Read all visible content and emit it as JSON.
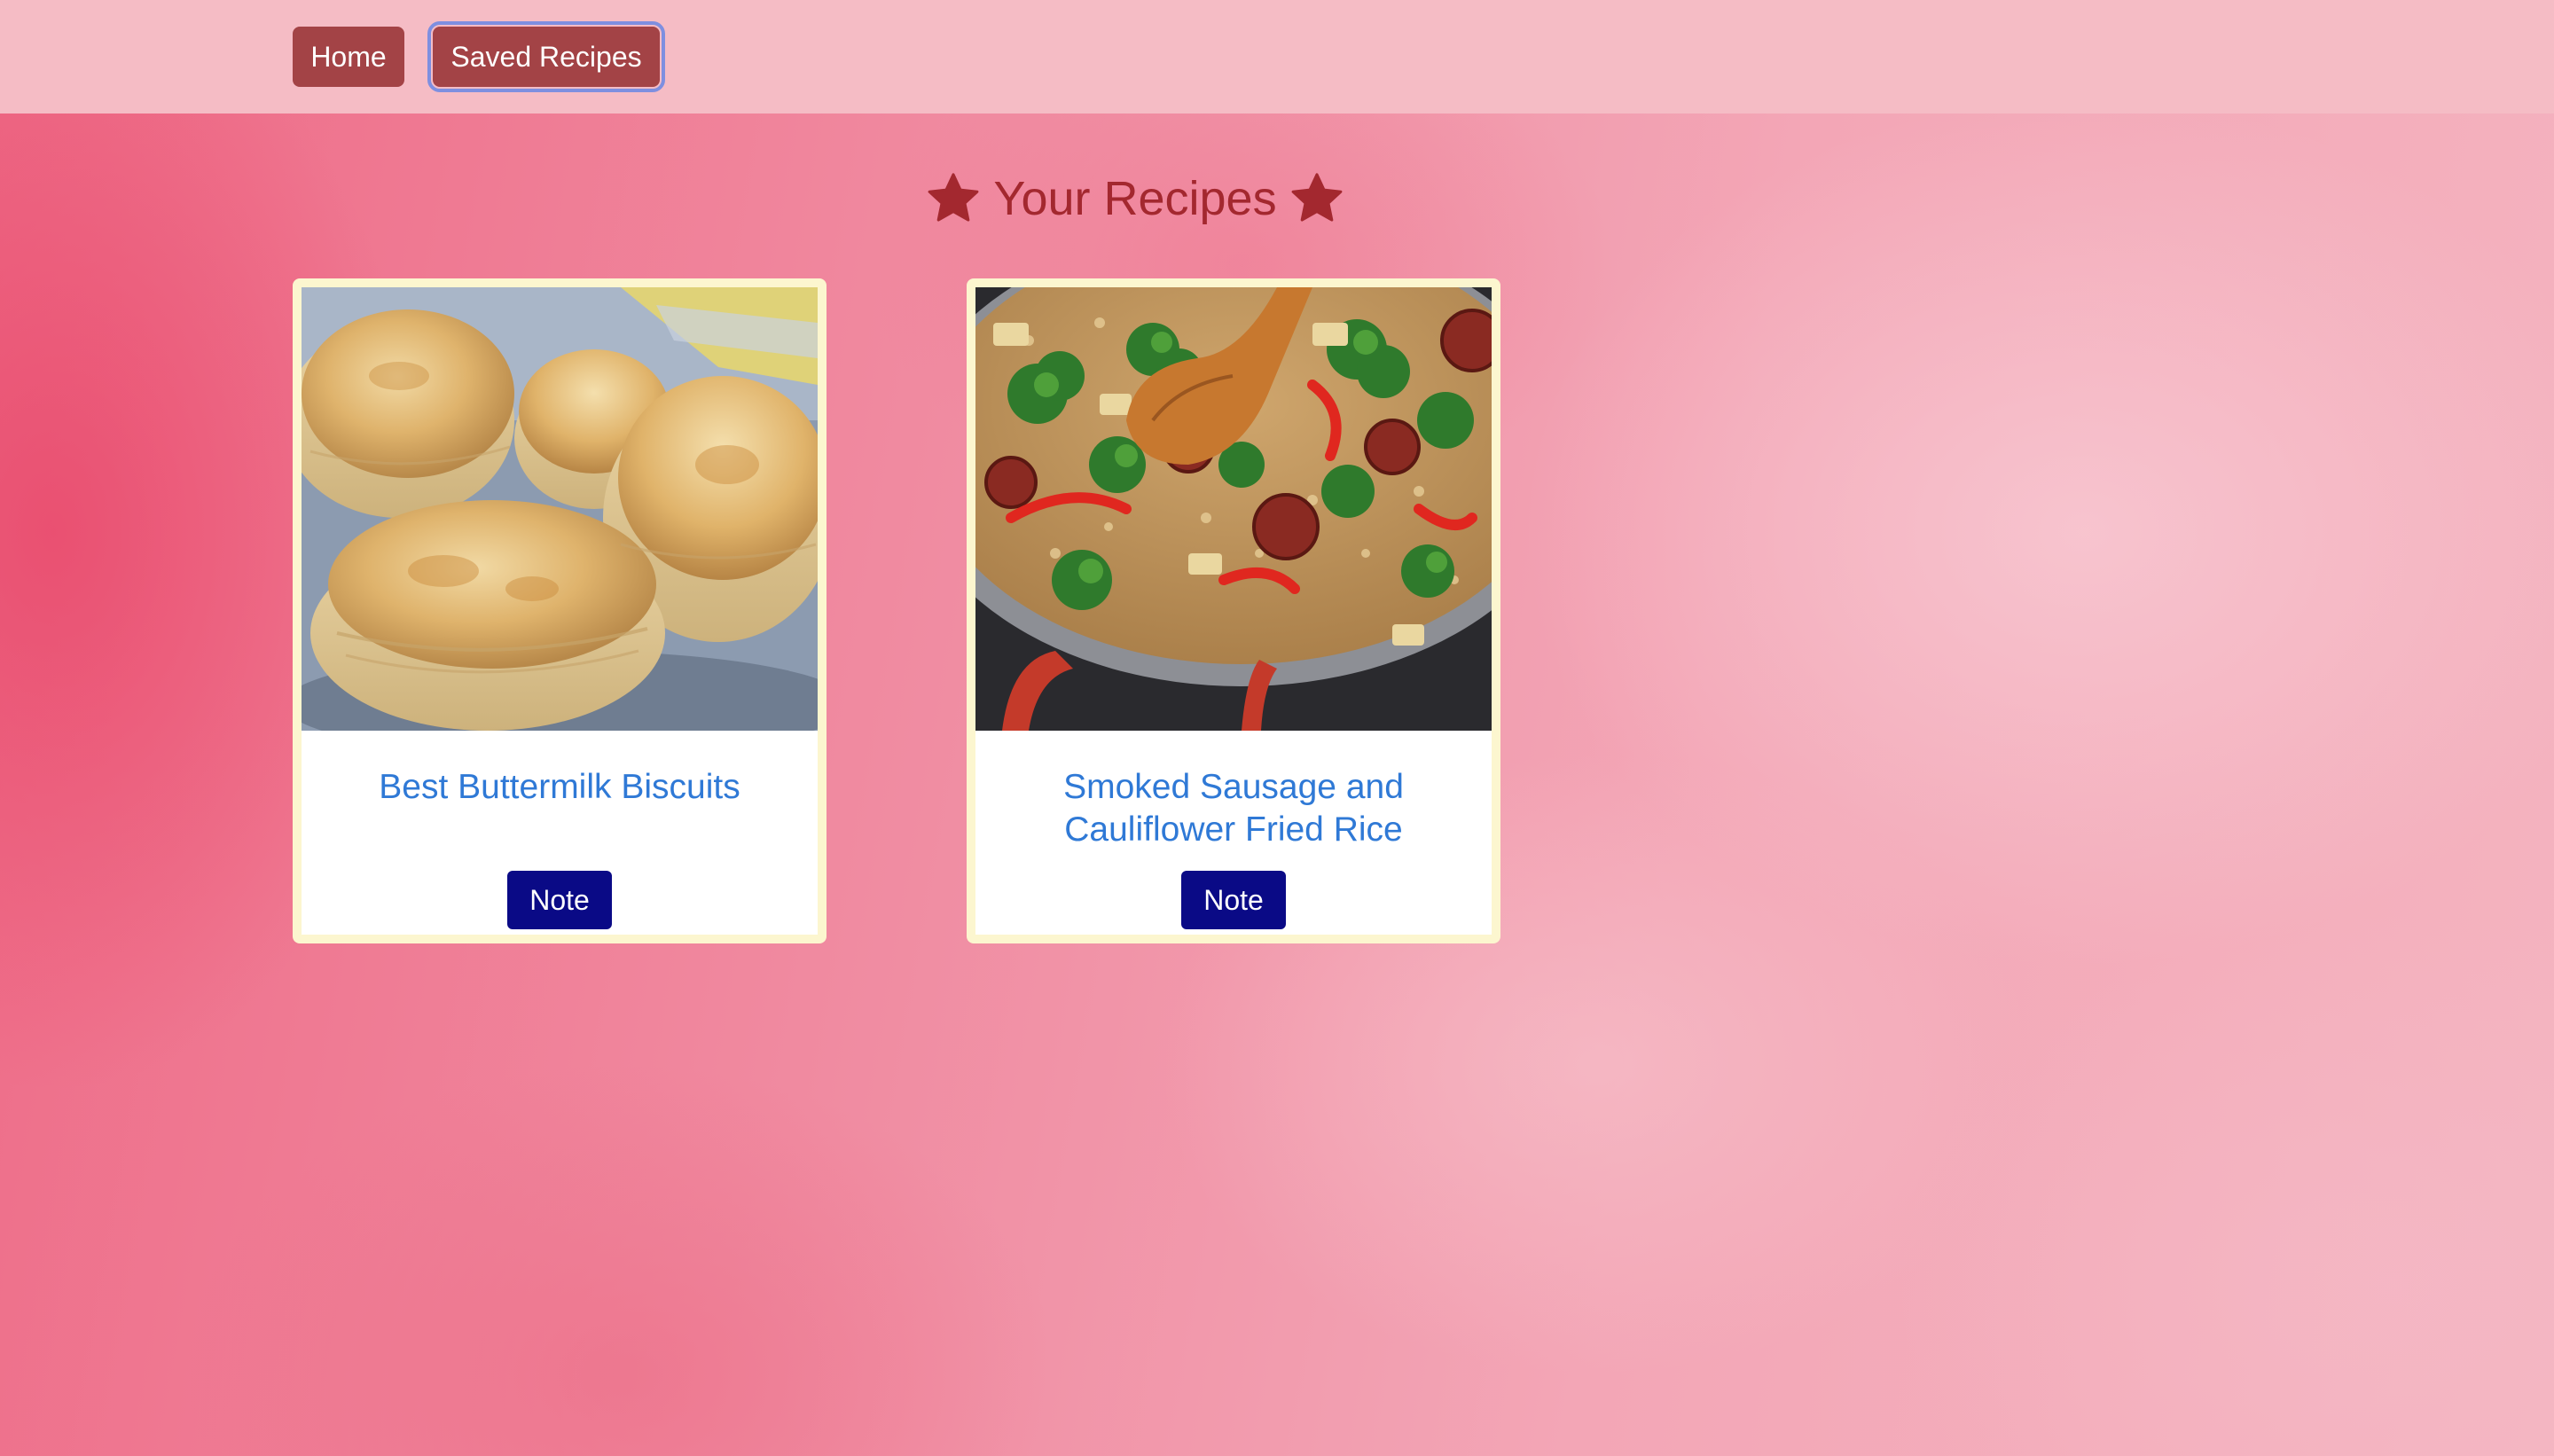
{
  "nav": {
    "home_label": "Home",
    "saved_label": "Saved Recipes"
  },
  "heading": {
    "text": "Your Recipes",
    "icon": "star-icon",
    "color": "#a3282f"
  },
  "recipes": [
    {
      "title": "Best Buttermilk Biscuits",
      "image": "buttermilk-biscuits-photo",
      "note_label": "Note"
    },
    {
      "title": "Smoked Sausage and Cauliflower Fried Rice",
      "image": "sausage-fried-rice-photo",
      "note_label": "Note"
    }
  ],
  "colors": {
    "nav_bg": "#f5bcc5",
    "nav_button": "#a34346",
    "card_border": "#fcf6cf",
    "link": "#2f79d6",
    "note_button": "#0a0a86"
  }
}
